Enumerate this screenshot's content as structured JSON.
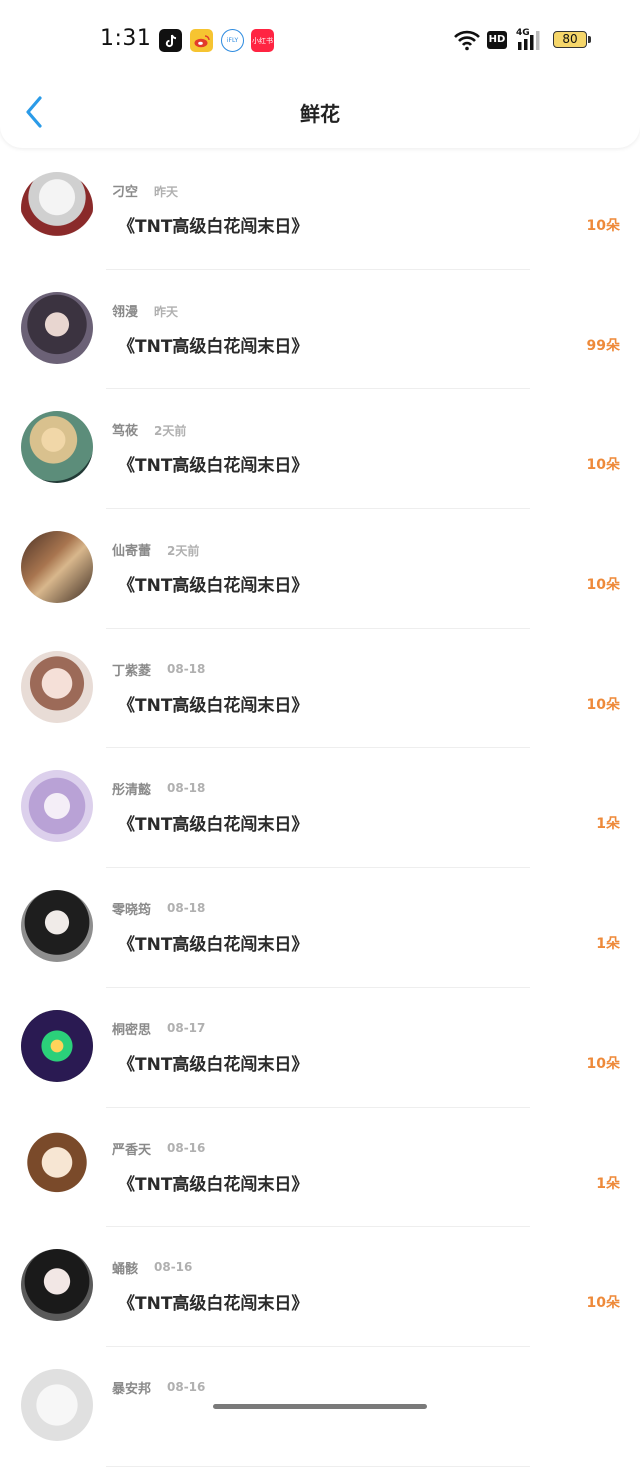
{
  "status_bar": {
    "time": "1:31",
    "apps": [
      "tiktok-icon",
      "weibo-icon",
      "iflytek-icon",
      "xiaohongshu-icon"
    ],
    "app3_text": "iFLY",
    "app4_text": "小红书",
    "hd_label": "HD",
    "network_label": "4G",
    "battery": "80"
  },
  "header": {
    "title": "鲜花",
    "back_icon": "chevron-left-icon",
    "accent": "#2b9be8"
  },
  "colors": {
    "count": "#ee8a3a"
  },
  "entries": [
    {
      "name": "刁空",
      "date": "昨天",
      "book": "《TNT高级白花闯末日》",
      "count": "10朵"
    },
    {
      "name": "翎漫",
      "date": "昨天",
      "book": "《TNT高级白花闯末日》",
      "count": "99朵"
    },
    {
      "name": "笃莜",
      "date": "2天前",
      "book": "《TNT高级白花闯末日》",
      "count": "10朵"
    },
    {
      "name": "仙寄蕾",
      "date": "2天前",
      "book": "《TNT高级白花闯末日》",
      "count": "10朵"
    },
    {
      "name": "丁紫菱",
      "date": "08-18",
      "book": "《TNT高级白花闯末日》",
      "count": "10朵"
    },
    {
      "name": "彤清懿",
      "date": "08-18",
      "book": "《TNT高级白花闯末日》",
      "count": "1朵"
    },
    {
      "name": "零晓筠",
      "date": "08-18",
      "book": "《TNT高级白花闯末日》",
      "count": "1朵"
    },
    {
      "name": "桐密思",
      "date": "08-17",
      "book": "《TNT高级白花闯末日》",
      "count": "10朵"
    },
    {
      "name": "严香天",
      "date": "08-16",
      "book": "《TNT高级白花闯末日》",
      "count": "1朵"
    },
    {
      "name": "蛹骸",
      "date": "08-16",
      "book": "《TNT高级白花闯末日》",
      "count": "10朵"
    },
    {
      "name": "暴安邦",
      "date": "08-16",
      "book": "",
      "count": ""
    }
  ]
}
